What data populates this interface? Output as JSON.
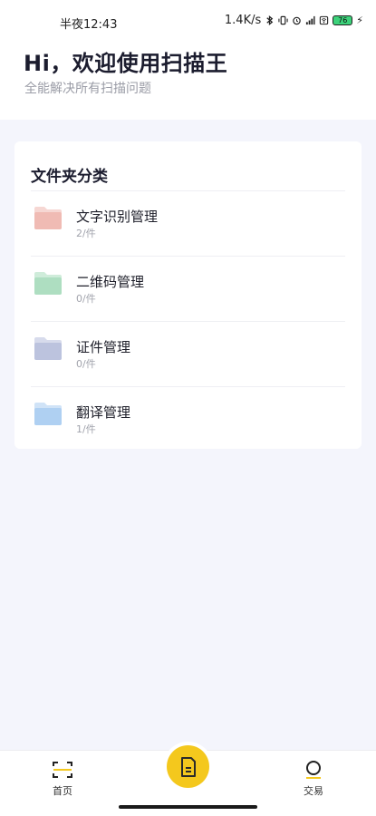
{
  "status_bar": {
    "time": "半夜12:43",
    "network_speed": "1.4K/s",
    "battery_level": "76"
  },
  "header": {
    "greeting": "Hi，欢迎使用扫描王",
    "subtitle": "全能解决所有扫描问题"
  },
  "folder_card": {
    "title": "文件夹分类",
    "items": [
      {
        "name": "文字识别管理",
        "count": "2/件",
        "icon": "folder-icon",
        "color": "#eeb6ae"
      },
      {
        "name": "二维码管理",
        "count": "0/件",
        "icon": "folder-icon",
        "color": "#a8dcbc"
      },
      {
        "name": "证件管理",
        "count": "0/件",
        "icon": "folder-icon",
        "color": "#b7bedc"
      },
      {
        "name": "翻译管理",
        "count": "1/件",
        "icon": "folder-icon",
        "color": "#a9ccf1"
      }
    ]
  },
  "bottom_nav": {
    "home_label": "首页",
    "trade_label": "交易",
    "accent_color": "#f4c81d"
  }
}
